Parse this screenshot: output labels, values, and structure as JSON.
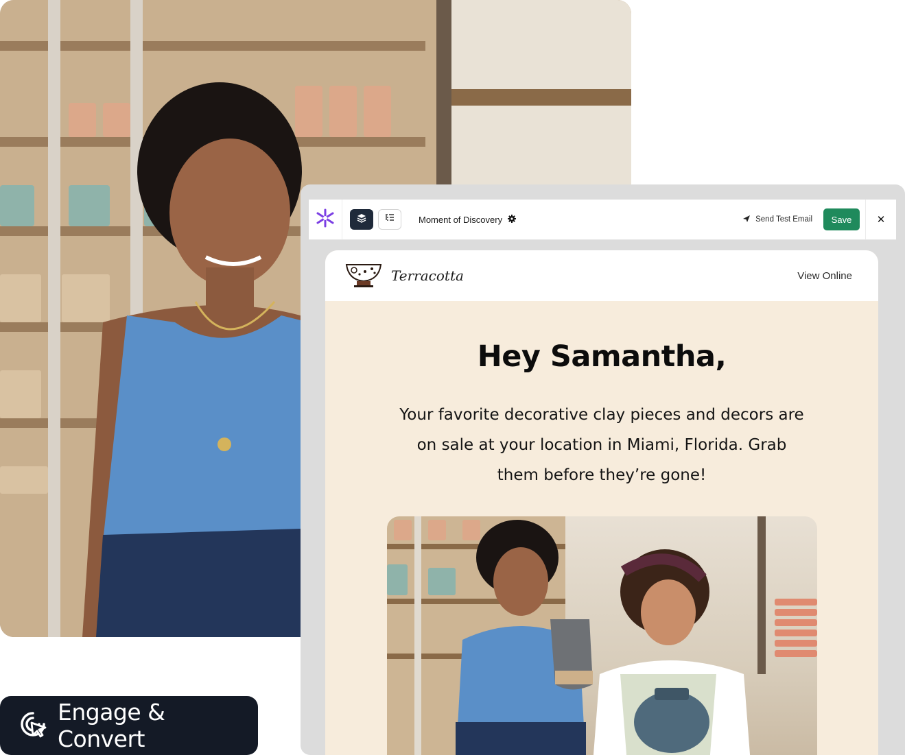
{
  "badge": {
    "label": "Engage & Convert",
    "icon": "cursor-click-icon"
  },
  "toolbar": {
    "logo_icon": "brand-asterisk-icon",
    "layers_icon": "layers-icon",
    "list_icon": "list-tree-icon",
    "title": "Moment of Discovery",
    "settings_icon": "gear-icon",
    "send_test_label": "Send Test Email",
    "send_icon": "paper-plane-icon",
    "save_label": "Save",
    "close_label": "✕"
  },
  "email": {
    "brand_name": "Terracotta",
    "brand_icon": "ceramic-bowl-icon",
    "view_online": "View Online",
    "headline": "Hey Samantha,",
    "body": "Your favorite decorative clay pieces and decors are on sale at your location in Miami, Florida. Grab them before they’re gone!"
  },
  "colors": {
    "save_button": "#1f8a5c",
    "badge_bg": "#141a26",
    "email_bg": "#f7ecdc",
    "logo_purple": "#7b3fe4"
  }
}
